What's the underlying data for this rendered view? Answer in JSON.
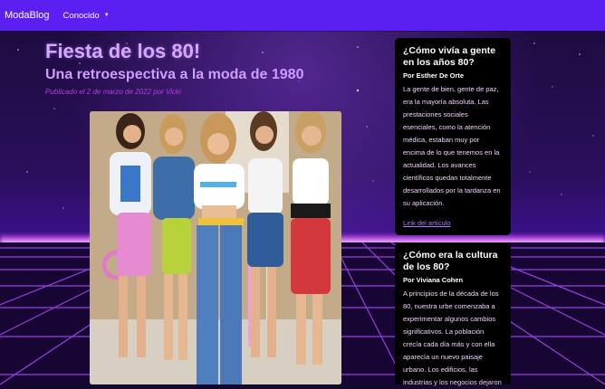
{
  "navbar": {
    "brand": "ModaBlog",
    "menu_label": "Conocido"
  },
  "article": {
    "title": "Fiesta de los 80!",
    "subtitle": "Una retroespectiva a la moda de 1980",
    "meta": "Publicado el 2 de marzo de 2022 por Vicki"
  },
  "sidebar": {
    "cards": [
      {
        "title": "¿Cómo vivía  a gente en los años 80?",
        "author": "Por Esther De Orte",
        "body": "La gente de bien, gente de paz, era la mayoría absoluta. Las prestaciones sociales esenciales, como la atención médica, estaban muy por encima de lo que tenemos en la actualidad. Los avances científicos quedan totalmente desarrollados por la tardanza en su aplicación.",
        "link": "Link del artículo"
      },
      {
        "title": "¿Cómo era la cultura de los 80?",
        "author": "Por Viviana Cohen",
        "body": "A principios de la década de los 80, nuestra urbe comenzaba a experimentar algunos cambios significativos. La población crecía cada día más y con ella aparecía un nuevo paisaje urbano. Los edificios, las industrias y los negocios dejaron"
      }
    ]
  },
  "colors": {
    "navbar": "#5b1ff2",
    "title": "#d6a8ff",
    "meta": "#b040d8",
    "link": "#a87bff",
    "card_bg": "#000000"
  }
}
